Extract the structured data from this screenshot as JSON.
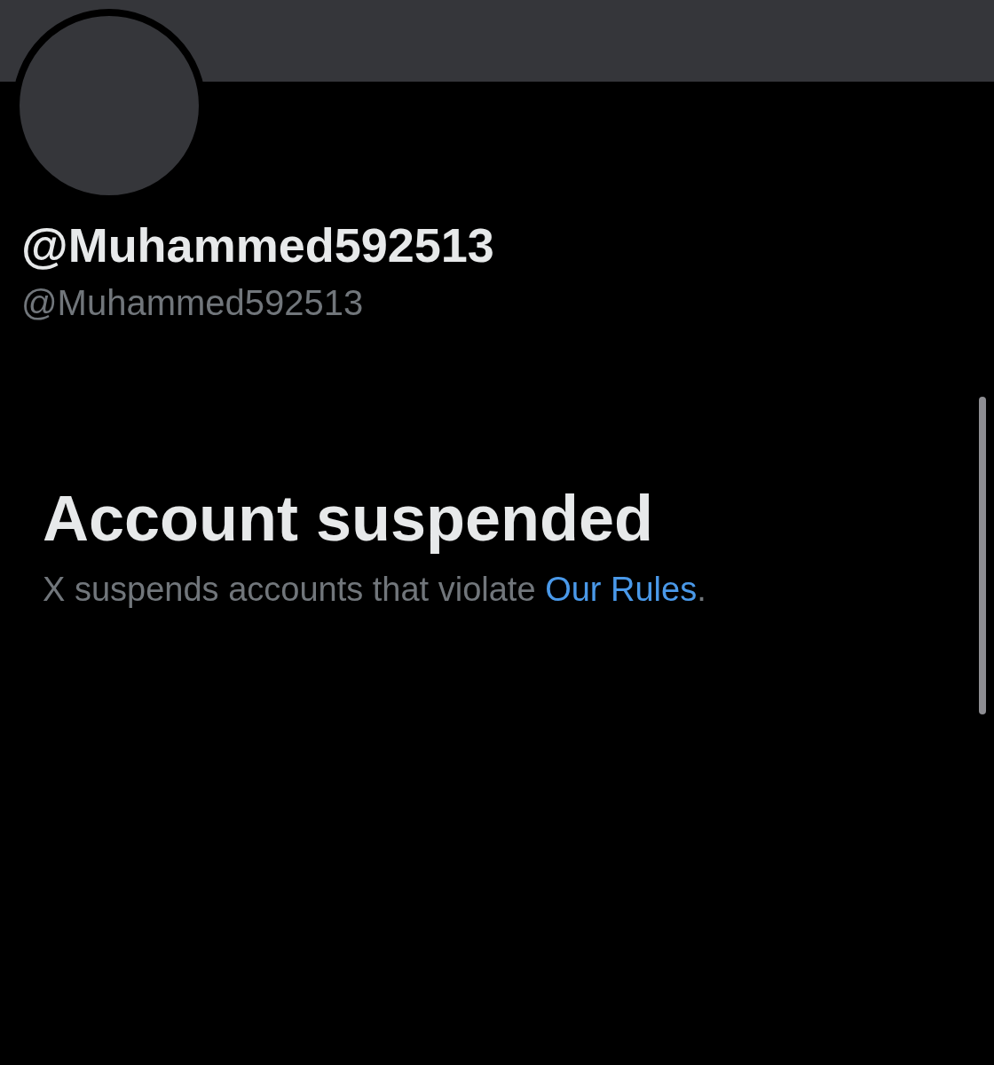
{
  "profile": {
    "display_name": "@Muhammed592513",
    "handle": "@Muhammed592513"
  },
  "notice": {
    "title": "Account suspended",
    "text_before": "X suspends accounts that violate ",
    "link": "Our Rules",
    "text_after": "."
  }
}
